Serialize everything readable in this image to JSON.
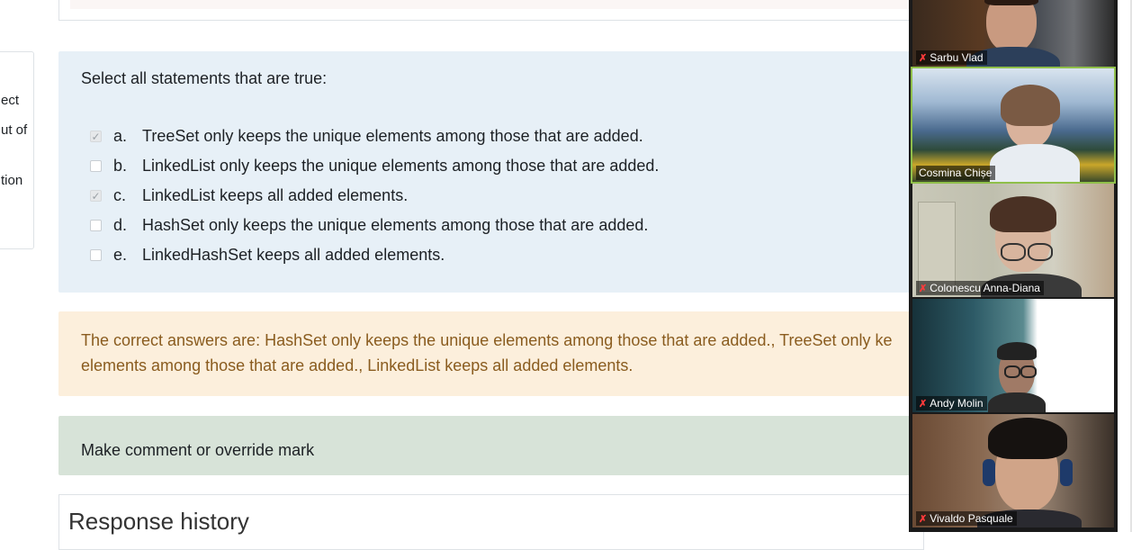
{
  "left_panel": {
    "fragments": [
      "ect",
      "ut of",
      "tion"
    ]
  },
  "question": {
    "prompt": "Select all statements that are true:",
    "answers": [
      {
        "letter": "a.",
        "text": "TreeSet only keeps the unique elements among those that are added.",
        "checked": true
      },
      {
        "letter": "b.",
        "text": "LinkedList only keeps the unique elements among those that are added.",
        "checked": false
      },
      {
        "letter": "c.",
        "text": "LinkedList keeps all added elements.",
        "checked": true
      },
      {
        "letter": "d.",
        "text": "HashSet only keeps the unique elements among those that are added.",
        "checked": false
      },
      {
        "letter": "e.",
        "text": "LinkedHashSet keeps all added elements.",
        "checked": false
      }
    ]
  },
  "outcome": {
    "line1": "The correct answers are: HashSet only keeps the unique elements among those that are added., TreeSet only ke",
    "line2": "elements among those that are added., LinkedList keeps all added elements."
  },
  "comment": {
    "label": "Make comment or override mark"
  },
  "history": {
    "title": "Response history"
  },
  "participants": [
    {
      "name": "Sarbu Vlad",
      "muted": true
    },
    {
      "name": "Cosmina Chișe",
      "muted": false,
      "active": true
    },
    {
      "name": "Colonescu Anna-Diana",
      "muted": true
    },
    {
      "name": "Andy Molin",
      "muted": true
    },
    {
      "name": "Vivaldo Pasquale",
      "muted": true
    }
  ],
  "colors": {
    "formulation_bg": "#e7f0f7",
    "outcome_bg": "#fcefdc",
    "outcome_text": "#8a5c1f",
    "comment_bg": "#d7e3d8",
    "active_speaker": "#8fbf4a",
    "muted_icon": "#ff3b3b"
  }
}
